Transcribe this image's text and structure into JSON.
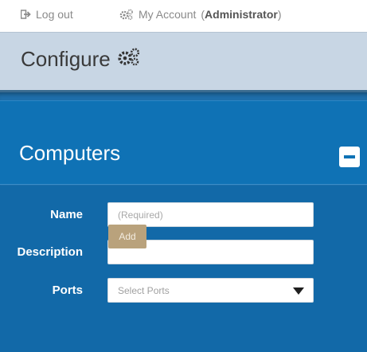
{
  "topbar": {
    "logout_label": "Log out",
    "account_label": "My Account",
    "account_role_open": "(",
    "account_role": "Administrator",
    "account_role_close": ")"
  },
  "configure": {
    "title": "Configure"
  },
  "panel": {
    "title": "Computers"
  },
  "form": {
    "name_label": "Name",
    "name_placeholder": "(Required)",
    "description_label": "Description",
    "description_value": "",
    "ports_label": "Ports",
    "ports_placeholder": "Select Ports",
    "add_label": "Add"
  },
  "colors": {
    "panel_blue": "#1f6fab",
    "header_blue": "#0f72b5",
    "configure_bg": "#c8d6e4",
    "add_button": "#b9a27c"
  },
  "icons": {
    "logout": "logout-icon",
    "account": "gears-icon",
    "configure": "gears-icon",
    "collapse": "minus-square-icon",
    "dropdown": "caret-down-icon"
  }
}
